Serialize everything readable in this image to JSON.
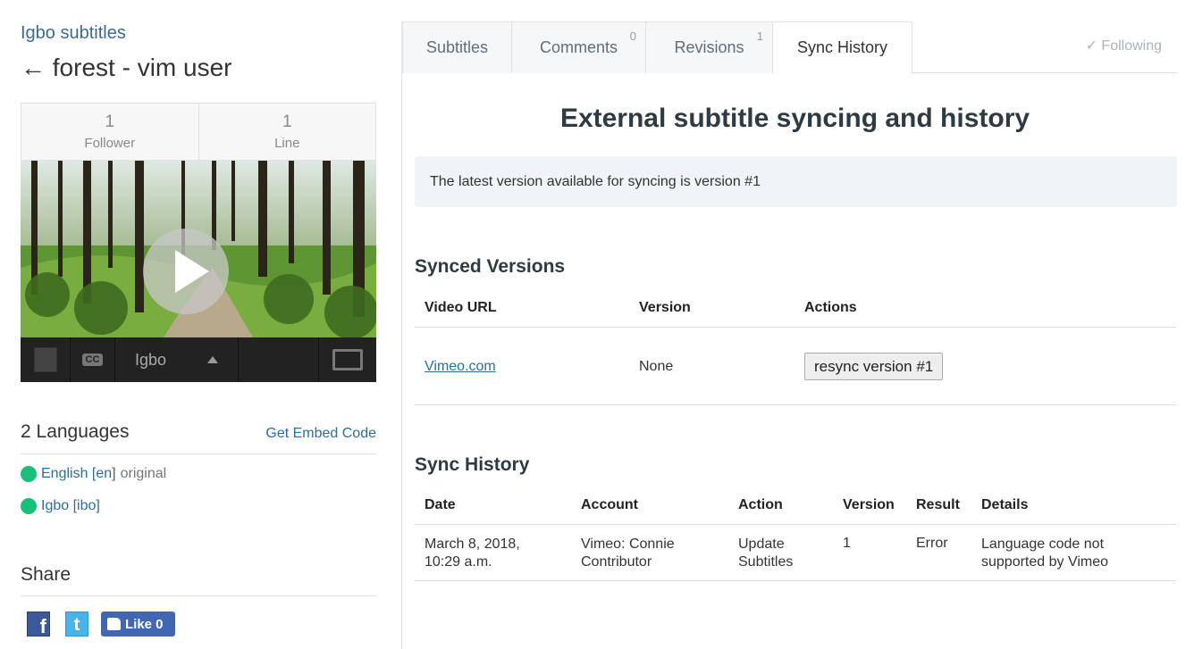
{
  "sidebar": {
    "team_link": "Igbo subtitles",
    "video_title": "← forest - vim user",
    "stats": [
      {
        "num": "1",
        "label": "Follower"
      },
      {
        "num": "1",
        "label": "Line"
      }
    ],
    "player": {
      "language": "Igbo",
      "cc_label": "CC",
      "icons": [
        "transcript-icon",
        "cc-icon",
        "caret-up-icon",
        "fullscreen-icon",
        "play-icon"
      ]
    },
    "languages_header": "2 Languages",
    "embed_link": "Get Embed Code",
    "languages": [
      {
        "name": "English [en]",
        "note": "original",
        "status_color": "#18c07a"
      },
      {
        "name": "Igbo [ibo]",
        "note": "",
        "status_color": "#18c07a"
      }
    ],
    "share_header": "Share",
    "social": {
      "facebook": "f",
      "twitter": "t",
      "like_label": "Like 0"
    }
  },
  "tabs": [
    {
      "label": "Subtitles",
      "badge": ""
    },
    {
      "label": "Comments",
      "badge": "0"
    },
    {
      "label": "Revisions",
      "badge": "1"
    },
    {
      "label": "Sync History",
      "badge": "",
      "active": true
    }
  ],
  "following": "✓ Following",
  "main": {
    "heading": "External subtitle syncing and history",
    "notice": "The latest version available for syncing is version #1",
    "synced_versions": {
      "title": "Synced Versions",
      "columns": [
        "Video URL",
        "Version",
        "Actions"
      ],
      "rows": [
        {
          "url": "Vimeo.com",
          "version": "None",
          "action": "resync version #1"
        }
      ]
    },
    "sync_history": {
      "title": "Sync History",
      "columns": [
        "Date",
        "Account",
        "Action",
        "Version",
        "Result",
        "Details"
      ],
      "rows": [
        {
          "date_line1": "March 8, 2018,",
          "date_line2": "10:29 a.m.",
          "account_line1": "Vimeo: Connie",
          "account_line2": "Contributor",
          "action_line1": "Update",
          "action_line2": "Subtitles",
          "version": "1",
          "result": "Error",
          "details_line1": "Language code not",
          "details_line2": "supported by Vimeo"
        }
      ]
    }
  },
  "colors": {
    "link": "#2e6d9b",
    "status_green": "#18c07a",
    "notice_bg": "#f0f4f7"
  }
}
